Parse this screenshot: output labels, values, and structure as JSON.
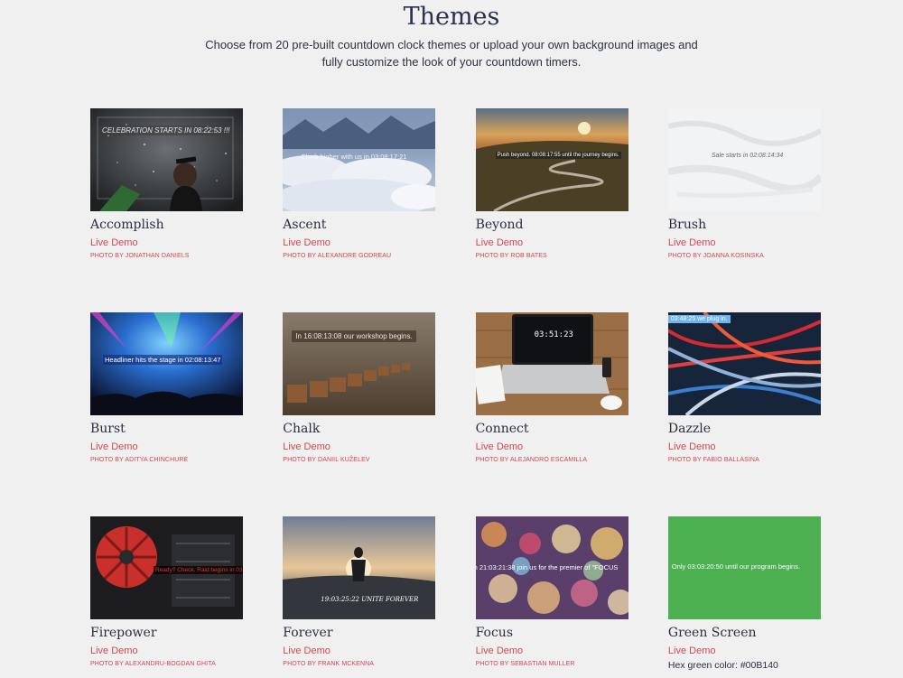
{
  "header": {
    "title": "Themes",
    "subtitle": "Choose from 20 pre-built countdown clock themes or upload your own background images and fully customize the look of your countdown timers."
  },
  "themes": [
    {
      "name": "Accomplish",
      "demo": "Live Demo",
      "credit": "PHOTO BY JONATHAN DANIELS",
      "overlay": "CELEBRATION STARTS IN 08:22:53 !!!",
      "image": "graduate-champagne-image"
    },
    {
      "name": "Ascent",
      "demo": "Live Demo",
      "credit": "PHOTO BY ALEXANDRE GODREAU",
      "overlay": "Climb higher with us in 03:08:17:21",
      "image": "mountains-clouds-image"
    },
    {
      "name": "Beyond",
      "demo": "Live Demo",
      "credit": "PHOTO BY ROB BATES",
      "overlay": "Push beyond. 08:08:17:55 until the journey begins.",
      "image": "winding-road-sunset-image"
    },
    {
      "name": "Brush",
      "demo": "Live Demo",
      "credit": "PHOTO BY JOANNA KOSINSKA",
      "overlay": "Sale starts in 02:08:14:34",
      "image": "white-paint-texture-image"
    },
    {
      "name": "Burst",
      "demo": "Live Demo",
      "credit": "PHOTO BY ADITYA CHINCHURE",
      "overlay": "Headliner hits the stage in 02:08:13:47",
      "image": "concert-lights-image"
    },
    {
      "name": "Chalk",
      "demo": "Live Demo",
      "credit": "PHOTO BY DANIIL KUŽELEV",
      "overlay": "In 16:08:13:08 our workshop begins.",
      "image": "lecture-hall-chairs-image"
    },
    {
      "name": "Connect",
      "demo": "Live Demo",
      "credit": "PHOTO BY ALEJANDRO ESCAMILLA",
      "overlay": "03:51:23",
      "image": "laptop-desk-image"
    },
    {
      "name": "Dazzle",
      "demo": "Live Demo",
      "credit": "PHOTO BY FABIO BALLASINA",
      "overlay": "03:48:25 we plug in.",
      "image": "abstract-streaks-image"
    },
    {
      "name": "Firepower",
      "demo": "Live Demo",
      "credit": "PHOTO BY ALEXANDRU-BOGDAN GHITA",
      "overlay": "Ready? Check. Raid begins in 03:2",
      "image": "red-fan-engine-image"
    },
    {
      "name": "Forever",
      "demo": "Live Demo",
      "credit": "PHOTO BY FRANK MCKENNA",
      "overlay": "19:03:25:22 UNITE FOREVER",
      "image": "couple-sunset-image"
    },
    {
      "name": "Focus",
      "demo": "Live Demo",
      "credit": "PHOTO BY SEBASTIAN MULLER",
      "overlay": "n 21:03:21:38 join us for the premier of \"FOCUS",
      "image": "bokeh-lights-image"
    },
    {
      "name": "Green Screen",
      "demo": "Live Demo",
      "credit": "",
      "hex_note": "Hex green color: #00B140",
      "overlay": "Only 03:03:20:50 until our program begins.",
      "image": "green-screen-image",
      "color": "#4caf50"
    }
  ]
}
